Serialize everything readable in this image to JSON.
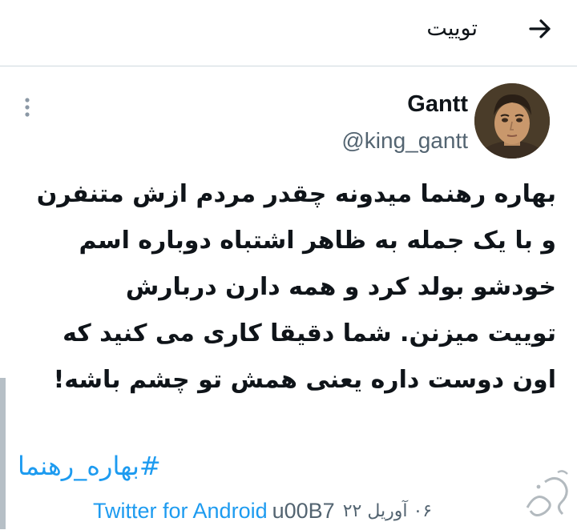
{
  "header": {
    "title": "توییت",
    "back_icon": "arrow-right-icon"
  },
  "tweet": {
    "display_name": "Gantt",
    "handle": "@king_gantt",
    "more_icon": "more-vertical-icon",
    "body_lines": [
      "بهاره رهنما میدونه چقدر مردم ازش متنفرن",
      "و با یک جمله به ظاهر اشتباه دوباره اسم",
      "خودشو بولد کرد و همه دارن دربارش",
      "توییت میزنن. شما دقیقا کاری می کنید که",
      "اون دوست داره یعنی همش تو چشم باشه!"
    ],
    "hashtag": "#بهاره_رهنما",
    "date": "۰۶ آوریل ۲۲",
    "separator_code": "u00B7",
    "source": "Twitter for Android"
  },
  "colors": {
    "link": "#1d9bf0",
    "secondary_text": "#536471",
    "divider": "#cfd9de"
  }
}
